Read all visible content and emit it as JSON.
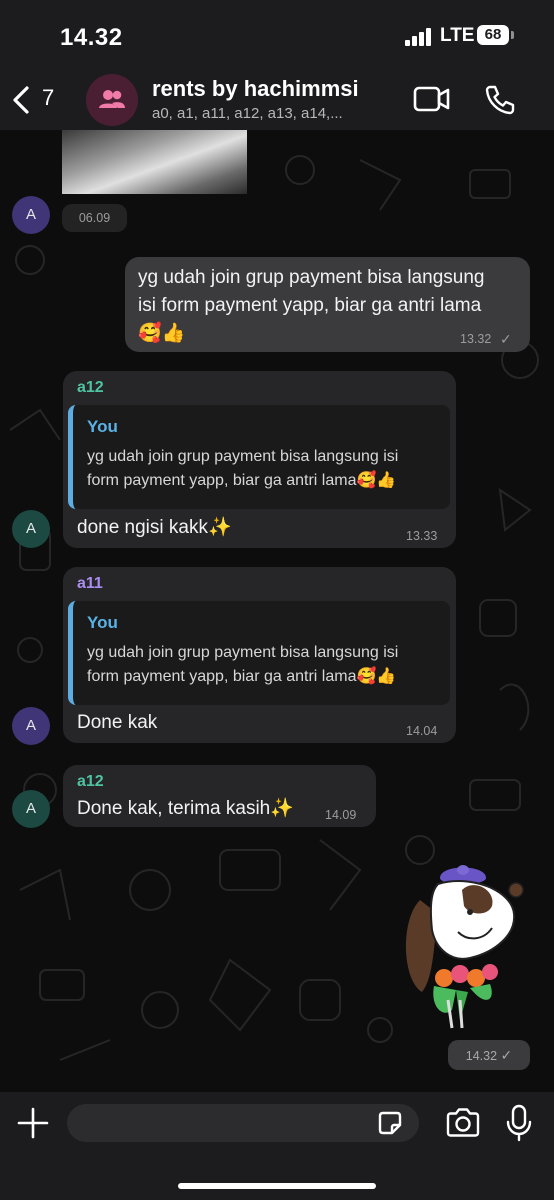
{
  "status_bar": {
    "time": "14.32",
    "network": "LTE",
    "battery": "68"
  },
  "header": {
    "back_count": "7",
    "title": "rents by hachimmsi",
    "members": "a0, a1, a11, a12, a13, a14,..."
  },
  "messages": {
    "photo_time": "06.09",
    "photo_avatar": "A",
    "outgoing": {
      "line1": "yg udah join grup payment bisa langsung",
      "line2": "isi form payment yapp, biar ga antri lama",
      "emoji": "🥰👍",
      "time": "13.32",
      "status": "✓"
    },
    "reply1": {
      "avatar": "A",
      "sender": "a12",
      "quote_author": "You",
      "quote_line1": "yg udah join grup payment bisa langsung isi",
      "quote_line2": "form payment yapp, biar ga antri lama🥰👍",
      "text": "done ngisi kakk✨",
      "time": "13.33"
    },
    "reply2": {
      "avatar": "A",
      "sender": "a11",
      "quote_author": "You",
      "quote_line1": "yg udah join grup payment bisa langsung isi",
      "quote_line2": "form payment yapp, biar ga antri lama🥰👍",
      "text": "Done kak",
      "time": "14.04"
    },
    "reply3": {
      "avatar": "A",
      "sender": "a12",
      "text": "Done kak, terima kasih✨",
      "time": "14.09"
    },
    "sticker": {
      "time": "14.32",
      "status": "✓"
    }
  },
  "colors": {
    "bubble_in": "#262628",
    "bubble_out": "#3b3b3d",
    "quote_bar": "#5dade2",
    "sender_a12": "#4fc3a1",
    "sender_a11": "#a98df0",
    "avatar_purple": "#3f3577",
    "avatar_teal": "#1c4a43"
  },
  "icons": {
    "header": [
      "chevron-left-icon",
      "group-icon",
      "video-call-icon",
      "phone-icon"
    ],
    "input": [
      "plus-icon",
      "sticker-icon",
      "camera-icon",
      "microphone-icon"
    ]
  }
}
